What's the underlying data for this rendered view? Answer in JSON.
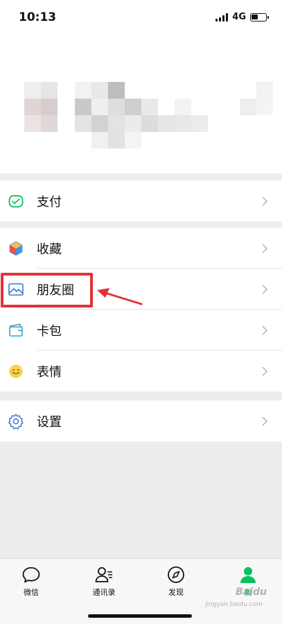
{
  "status_bar": {
    "time": "10:13",
    "network": "4G"
  },
  "menu": {
    "pay": {
      "label": "支付",
      "icon": "wallet-check-icon"
    },
    "favorites": {
      "label": "收藏",
      "icon": "cube-icon"
    },
    "moments": {
      "label": "朋友圈",
      "icon": "image-icon"
    },
    "cards": {
      "label": "卡包",
      "icon": "card-icon"
    },
    "stickers": {
      "label": "表情",
      "icon": "smiley-icon"
    },
    "settings": {
      "label": "设置",
      "icon": "gear-icon"
    }
  },
  "tabbar": {
    "tabs": [
      {
        "label": "微信",
        "icon": "chat-bubble-icon"
      },
      {
        "label": "通讯录",
        "icon": "contacts-icon"
      },
      {
        "label": "发现",
        "icon": "compass-icon"
      },
      {
        "label": "我",
        "icon": "person-icon"
      }
    ],
    "active_index": 3
  },
  "colors": {
    "accent": "#07c160",
    "highlight": "#e23236",
    "background": "#ededed"
  },
  "watermark": {
    "text": "Baidu",
    "sub": "jingyan.baidu.com"
  }
}
